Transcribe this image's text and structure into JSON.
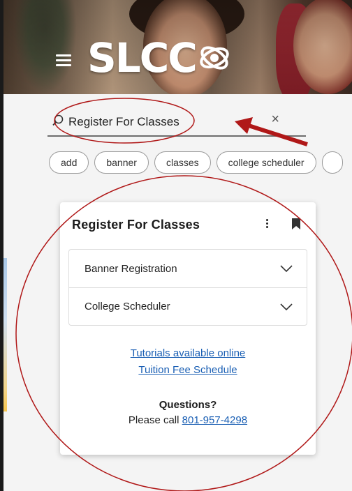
{
  "header": {
    "logo_text": "SLCC",
    "menu_icon": "hamburger-menu-icon",
    "logo_icon": "orbit-logo-icon"
  },
  "search": {
    "value": "Register For Classes",
    "placeholder": "Search",
    "search_icon": "magnifier-icon",
    "clear_icon": "close-icon"
  },
  "chips": [
    "add",
    "banner",
    "classes",
    "college scheduler"
  ],
  "card": {
    "title": "Register For Classes",
    "more_icon": "kebab-menu-icon",
    "bookmark_icon": "bookmark-icon",
    "accordion": [
      {
        "label": "Banner Registration"
      },
      {
        "label": "College Scheduler"
      }
    ],
    "links": {
      "tutorials": "Tutorials available online",
      "tuition": "Tuition Fee Schedule"
    },
    "questions": {
      "heading": "Questions?",
      "prefix": "Please call ",
      "phone": "801-957-4298"
    }
  },
  "colors": {
    "link": "#1a5fb4",
    "annotation": "#b01818"
  }
}
